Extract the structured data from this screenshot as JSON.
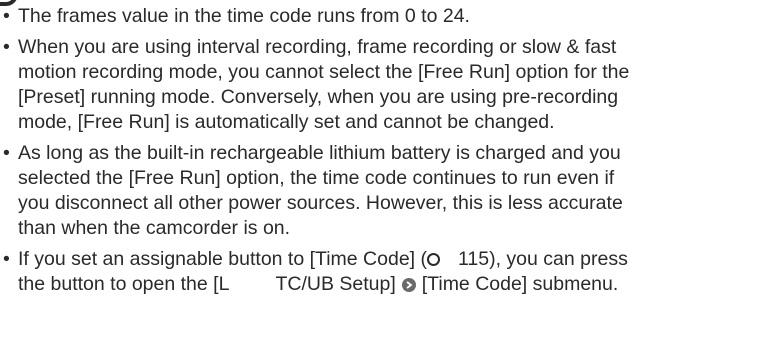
{
  "notes": [
    {
      "lines": [
        "The frames value in the time code runs from 0 to 24."
      ]
    },
    {
      "lines": [
        "When you are using interval recording, frame recording or slow & fast",
        "motion recording mode, you cannot select the [Free Run] option for the",
        "[Preset] running mode. Conversely, when you are using pre-recording",
        "mode, [Free Run] is automatically set and cannot be changed."
      ]
    },
    {
      "lines": [
        "As long as the built-in rechargeable lithium battery is charged and you",
        "selected the [Free Run] option, the time code continues to run even if",
        "you disconnect all other power sources. However, this is less accurate",
        "than when the camcorder is on."
      ]
    },
    {
      "line1_before_icon": "If you set an assignable button to [Time Code] (",
      "line1_page": "115), you can press",
      "line2_start": "the button to open the [",
      "line2_setup": "TC/UB Setup]",
      "line2_end": "[Time Code] submenu."
    }
  ],
  "bullet_char": "•",
  "page_ref_icon": "page-reference-icon",
  "menu_arrow_icon": "menu-arrow-icon"
}
